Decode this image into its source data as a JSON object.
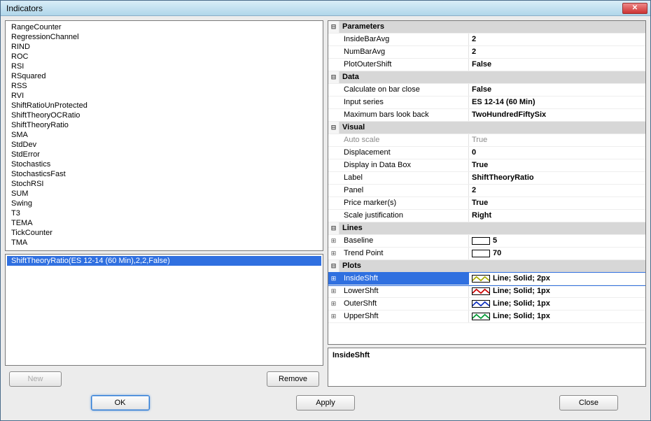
{
  "window": {
    "title": "Indicators"
  },
  "indicators": [
    "RangeCounter",
    "RegressionChannel",
    "RIND",
    "ROC",
    "RSI",
    "RSquared",
    "RSS",
    "RVI",
    "ShiftRatioUnProtected",
    "ShiftTheoryOCRatio",
    "ShiftTheoryRatio",
    "SMA",
    "StdDev",
    "StdError",
    "Stochastics",
    "StochasticsFast",
    "StochRSI",
    "SUM",
    "Swing",
    "T3",
    "TEMA",
    "TickCounter",
    "TMA"
  ],
  "applied": {
    "selected_index": 0,
    "items": [
      "ShiftTheoryRatio(ES 12-14 (60 Min),2,2,False)"
    ]
  },
  "buttons": {
    "new": "New",
    "remove": "Remove",
    "ok": "OK",
    "apply": "Apply",
    "close": "Close"
  },
  "categories": {
    "parameters": "Parameters",
    "data": "Data",
    "visual": "Visual",
    "lines": "Lines",
    "plots": "Plots"
  },
  "params": {
    "InsideBarAvg": {
      "label": "InsideBarAvg",
      "value": "2"
    },
    "NumBarAvg": {
      "label": "NumBarAvg",
      "value": "2"
    },
    "PlotOuterShift": {
      "label": "PlotOuterShift",
      "value": "False"
    }
  },
  "data_section": {
    "CalcOnBarClose": {
      "label": "Calculate on bar close",
      "value": "False"
    },
    "InputSeries": {
      "label": "Input series",
      "value": "ES 12-14 (60 Min)"
    },
    "MaxBarsLookBack": {
      "label": "Maximum bars look back",
      "value": "TwoHundredFiftySix"
    }
  },
  "visual": {
    "AutoScale": {
      "label": "Auto scale",
      "value": "True",
      "readonly": true
    },
    "Displacement": {
      "label": "Displacement",
      "value": "0"
    },
    "DisplayInDataBox": {
      "label": "Display in Data Box",
      "value": "True"
    },
    "Label": {
      "label": "Label",
      "value": "ShiftTheoryRatio"
    },
    "Panel": {
      "label": "Panel",
      "value": "2"
    },
    "PriceMarkers": {
      "label": "Price marker(s)",
      "value": "True"
    },
    "ScaleJustification": {
      "label": "Scale justification",
      "value": "Right"
    }
  },
  "lines": {
    "Baseline": {
      "label": "Baseline",
      "value": "5",
      "color": "#ffffff"
    },
    "TrendPoint": {
      "label": "Trend Point",
      "value": "70",
      "color": "#ffffff"
    }
  },
  "plots": {
    "InsideShft": {
      "label": "InsideShft",
      "value": "Line; Solid; 2px",
      "color": "#ffff99",
      "stroke": "#aaaa00",
      "selected": true
    },
    "LowerShft": {
      "label": "LowerShft",
      "value": "Line; Solid; 1px",
      "color": "#ffffff",
      "stroke": "#cc0000"
    },
    "OuterShft": {
      "label": "OuterShft",
      "value": "Line; Solid; 1px",
      "color": "#ffffff",
      "stroke": "#1030c0"
    },
    "UpperShft": {
      "label": "UpperShft",
      "value": "Line; Solid; 1px",
      "color": "#ffffff",
      "stroke": "#009933"
    }
  },
  "description": {
    "title": "InsideShft",
    "text": ""
  },
  "icons": {
    "collapse": "⊟",
    "expand": "⊞"
  }
}
